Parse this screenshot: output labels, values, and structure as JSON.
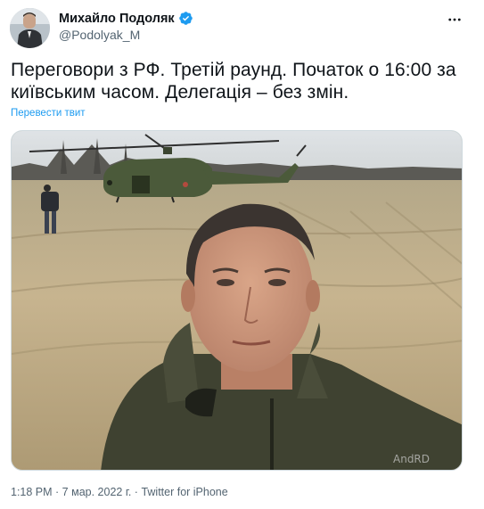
{
  "author": {
    "display_name": "Михайло Подоляк",
    "handle": "@Podolyak_M",
    "verified": true,
    "avatar_icon": "profile-photo"
  },
  "menu_icon": "more-dots-icon",
  "tweet": {
    "text": "Переговори з РФ. Третій раунд. Початок о 16:00 за київським часом. Делегація – без змін.",
    "translate_label": "Перевести твит"
  },
  "media": {
    "type": "photo",
    "watermark": "AndRD"
  },
  "meta": {
    "time": "1:18 PM",
    "separator": " · ",
    "date": "7 мар. 2022 г.",
    "separator2": " · ",
    "source": "Twitter for iPhone"
  },
  "colors": {
    "link": "#1d9bf0",
    "verified": "#1d9bf0",
    "secondary_text": "#536471"
  }
}
